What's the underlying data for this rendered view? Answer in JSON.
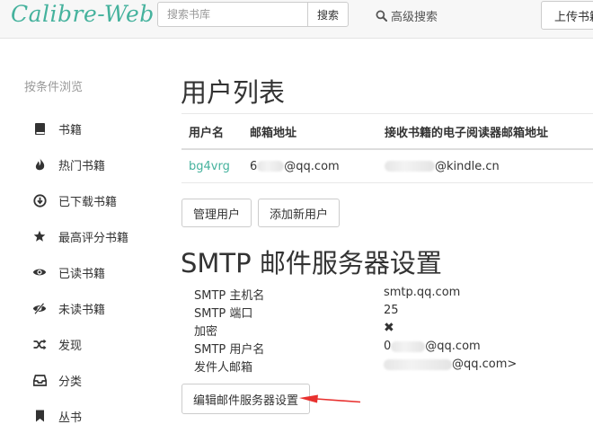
{
  "header": {
    "brand": "Calibre-Web",
    "search": {
      "placeholder": "搜索书库",
      "button_label": "搜索"
    },
    "advanced_search_label": "高级搜索",
    "upload_label": "上传书籍"
  },
  "sidebar": {
    "heading": "按条件浏览",
    "items": [
      {
        "label": "书籍",
        "icon": "book-icon"
      },
      {
        "label": "热门书籍",
        "icon": "fire-icon"
      },
      {
        "label": "已下载书籍",
        "icon": "download-icon"
      },
      {
        "label": "最高评分书籍",
        "icon": "star-icon"
      },
      {
        "label": "已读书籍",
        "icon": "eye-icon"
      },
      {
        "label": "未读书籍",
        "icon": "eye-slash-icon"
      },
      {
        "label": "发现",
        "icon": "shuffle-icon"
      },
      {
        "label": "分类",
        "icon": "inbox-icon"
      },
      {
        "label": "丛书",
        "icon": "bookmark-icon"
      }
    ]
  },
  "users": {
    "title": "用户列表",
    "columns": [
      "用户名",
      "邮箱地址",
      "接收书籍的电子阅读器邮箱地址"
    ],
    "rows": [
      {
        "username": "bg4vrg",
        "email_prefix": "6",
        "email_suffix": "@qq.com",
        "kindle_suffix": "@kindle.cn"
      }
    ],
    "manage_button": "管理用户",
    "add_button": "添加新用户"
  },
  "smtp": {
    "title": "SMTP 邮件服务器设置",
    "fields": [
      {
        "label": "SMTP 主机名",
        "value": "smtp.qq.com"
      },
      {
        "label": "SMTP 端口",
        "value": "25"
      },
      {
        "label": "加密",
        "value": "✖"
      },
      {
        "label": "SMTP 用户名",
        "prefix": "0",
        "suffix": "@qq.com"
      },
      {
        "label": "发件人邮箱",
        "prefix": "",
        "suffix": "@qq.com>"
      }
    ],
    "edit_button": "编辑邮件服务器设置"
  },
  "colors": {
    "accent": "#45b29d",
    "annotation_arrow": "#e8312f"
  }
}
